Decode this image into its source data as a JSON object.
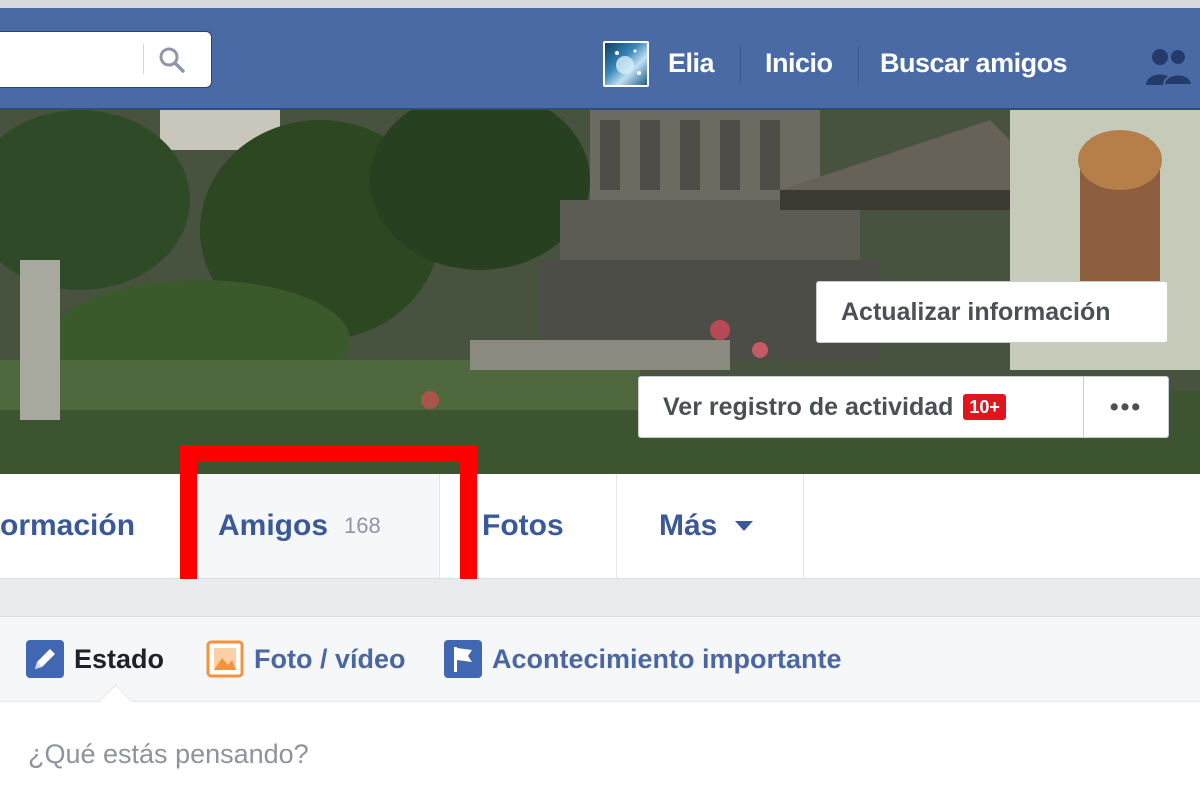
{
  "header": {
    "search_placeholder": "",
    "profile_name": "Elia",
    "home_label": "Inicio",
    "find_friends_label": "Buscar amigos",
    "brand_color": "#4a6aa6"
  },
  "cover": {
    "update_info_label": "Actualizar información",
    "activity_log_label": "Ver registro de actividad",
    "activity_badge": "10+",
    "more_options_label": "•••"
  },
  "tabs": [
    {
      "label": "ormación"
    },
    {
      "label": "Amigos",
      "count": "168"
    },
    {
      "label": "Fotos"
    },
    {
      "label": "Más"
    }
  ],
  "composer": {
    "tools": [
      {
        "label": "Estado",
        "icon": "pencil-icon",
        "color": "#4267b2"
      },
      {
        "label": "Foto / vídeo",
        "icon": "photo-icon",
        "color": "#f7923b"
      },
      {
        "label": "Acontecimiento importante",
        "icon": "flag-icon",
        "color": "#4267b2"
      }
    ],
    "placeholder": "¿Qué estás pensando?"
  },
  "highlight_color": "#ff0000"
}
